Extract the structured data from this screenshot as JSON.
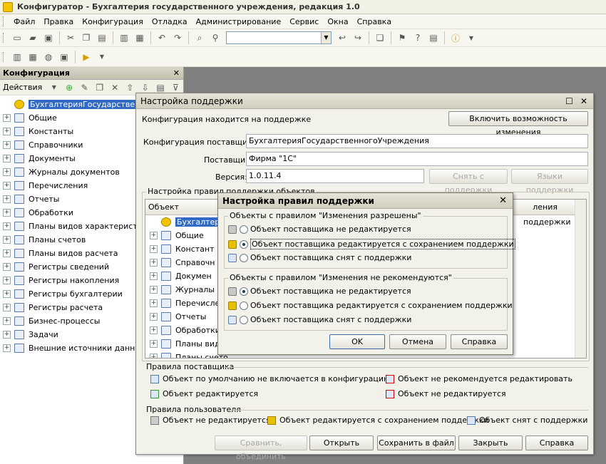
{
  "app": {
    "title": "Конфигуратор - Бухгалтерия государственного учреждения, редакция 1.0"
  },
  "menu": [
    "Файл",
    "Правка",
    "Конфигурация",
    "Отладка",
    "Администрирование",
    "Сервис",
    "Окна",
    "Справка"
  ],
  "left_panel": {
    "title": "Конфигурация",
    "actions_label": "Действия",
    "tree": [
      {
        "label": "БухгалтерияГосударственногоУ",
        "root": true
      },
      {
        "label": "Общие"
      },
      {
        "label": "Константы"
      },
      {
        "label": "Справочники"
      },
      {
        "label": "Документы"
      },
      {
        "label": "Журналы документов"
      },
      {
        "label": "Перечисления"
      },
      {
        "label": "Отчеты"
      },
      {
        "label": "Обработки"
      },
      {
        "label": "Планы видов характеристик"
      },
      {
        "label": "Планы счетов"
      },
      {
        "label": "Планы видов расчета"
      },
      {
        "label": "Регистры сведений"
      },
      {
        "label": "Регистры накопления"
      },
      {
        "label": "Регистры бухгалтерии"
      },
      {
        "label": "Регистры расчета"
      },
      {
        "label": "Бизнес-процессы"
      },
      {
        "label": "Задачи"
      },
      {
        "label": "Внешние источники данных"
      }
    ]
  },
  "support_dialog": {
    "title": "Настройка поддержки",
    "status_text": "Конфигурация находится на поддержке",
    "enable_changes_button": "Включить возможность изменения",
    "vendor_config_label": "Конфигурация поставщика:",
    "vendor_config_value": "БухгалтерияГосударственногоУчреждения",
    "vendor_label": "Поставщик:",
    "vendor_value": "Фирма \"1С\"",
    "version_label": "Версия:",
    "version_value": "1.0.11.4",
    "remove_support_button": "Снять с поддержки",
    "support_languages_button": "Языки поддержки",
    "rules_group_label": "Настройка правил поддержки объектов",
    "grid_header": "Объект",
    "grid_header_right": "ления",
    "grid_right_cell": "поддержки",
    "grid_rows": [
      {
        "label": "БухгалтерияГос",
        "root": true
      },
      {
        "label": "Общие"
      },
      {
        "label": "Констант"
      },
      {
        "label": "Справочн"
      },
      {
        "label": "Докумен"
      },
      {
        "label": "Журналы д"
      },
      {
        "label": "Перечисле"
      },
      {
        "label": "Отчеты"
      },
      {
        "label": "Обработки"
      },
      {
        "label": "Планы видо"
      },
      {
        "label": "Планы счето"
      }
    ],
    "vendor_rules_label": "Правила поставщика",
    "vendor_rules": [
      "Объект по умолчанию не включается в конфигурацию",
      "Объект не рекомендуется редактировать",
      "Объект редактируется",
      "Объект не редактируется"
    ],
    "user_rules_label": "Правила пользователя",
    "user_rules": [
      "Объект не редактируется",
      "Объект редактируется с сохранением поддержки",
      "Объект снят с поддержки"
    ],
    "buttons": {
      "compare": "Сравнить, объединить",
      "open": "Открыть",
      "save_to_file": "Сохранить в файл",
      "close": "Закрыть",
      "help": "Справка"
    }
  },
  "rules_dialog": {
    "title": "Настройка правил поддержки",
    "group1_label": "Объекты с правилом \"Изменения разрешены\"",
    "group1_options": [
      {
        "label": "Объект поставщика не редактируется",
        "selected": false
      },
      {
        "label": "Объект поставщика редактируется с сохранением поддержки",
        "selected": true
      },
      {
        "label": "Объект поставщика снят с поддержки",
        "selected": false
      }
    ],
    "group2_label": "Объекты с правилом \"Изменения не рекомендуются\"",
    "group2_options": [
      {
        "label": "Объект поставщика не редактируется",
        "selected": true
      },
      {
        "label": "Объект поставщика редактируется с сохранением поддержки",
        "selected": false
      },
      {
        "label": "Объект поставщика снят с поддержки",
        "selected": false
      }
    ],
    "ok_button": "OK",
    "cancel_button": "Отмена",
    "help_button": "Справка"
  }
}
